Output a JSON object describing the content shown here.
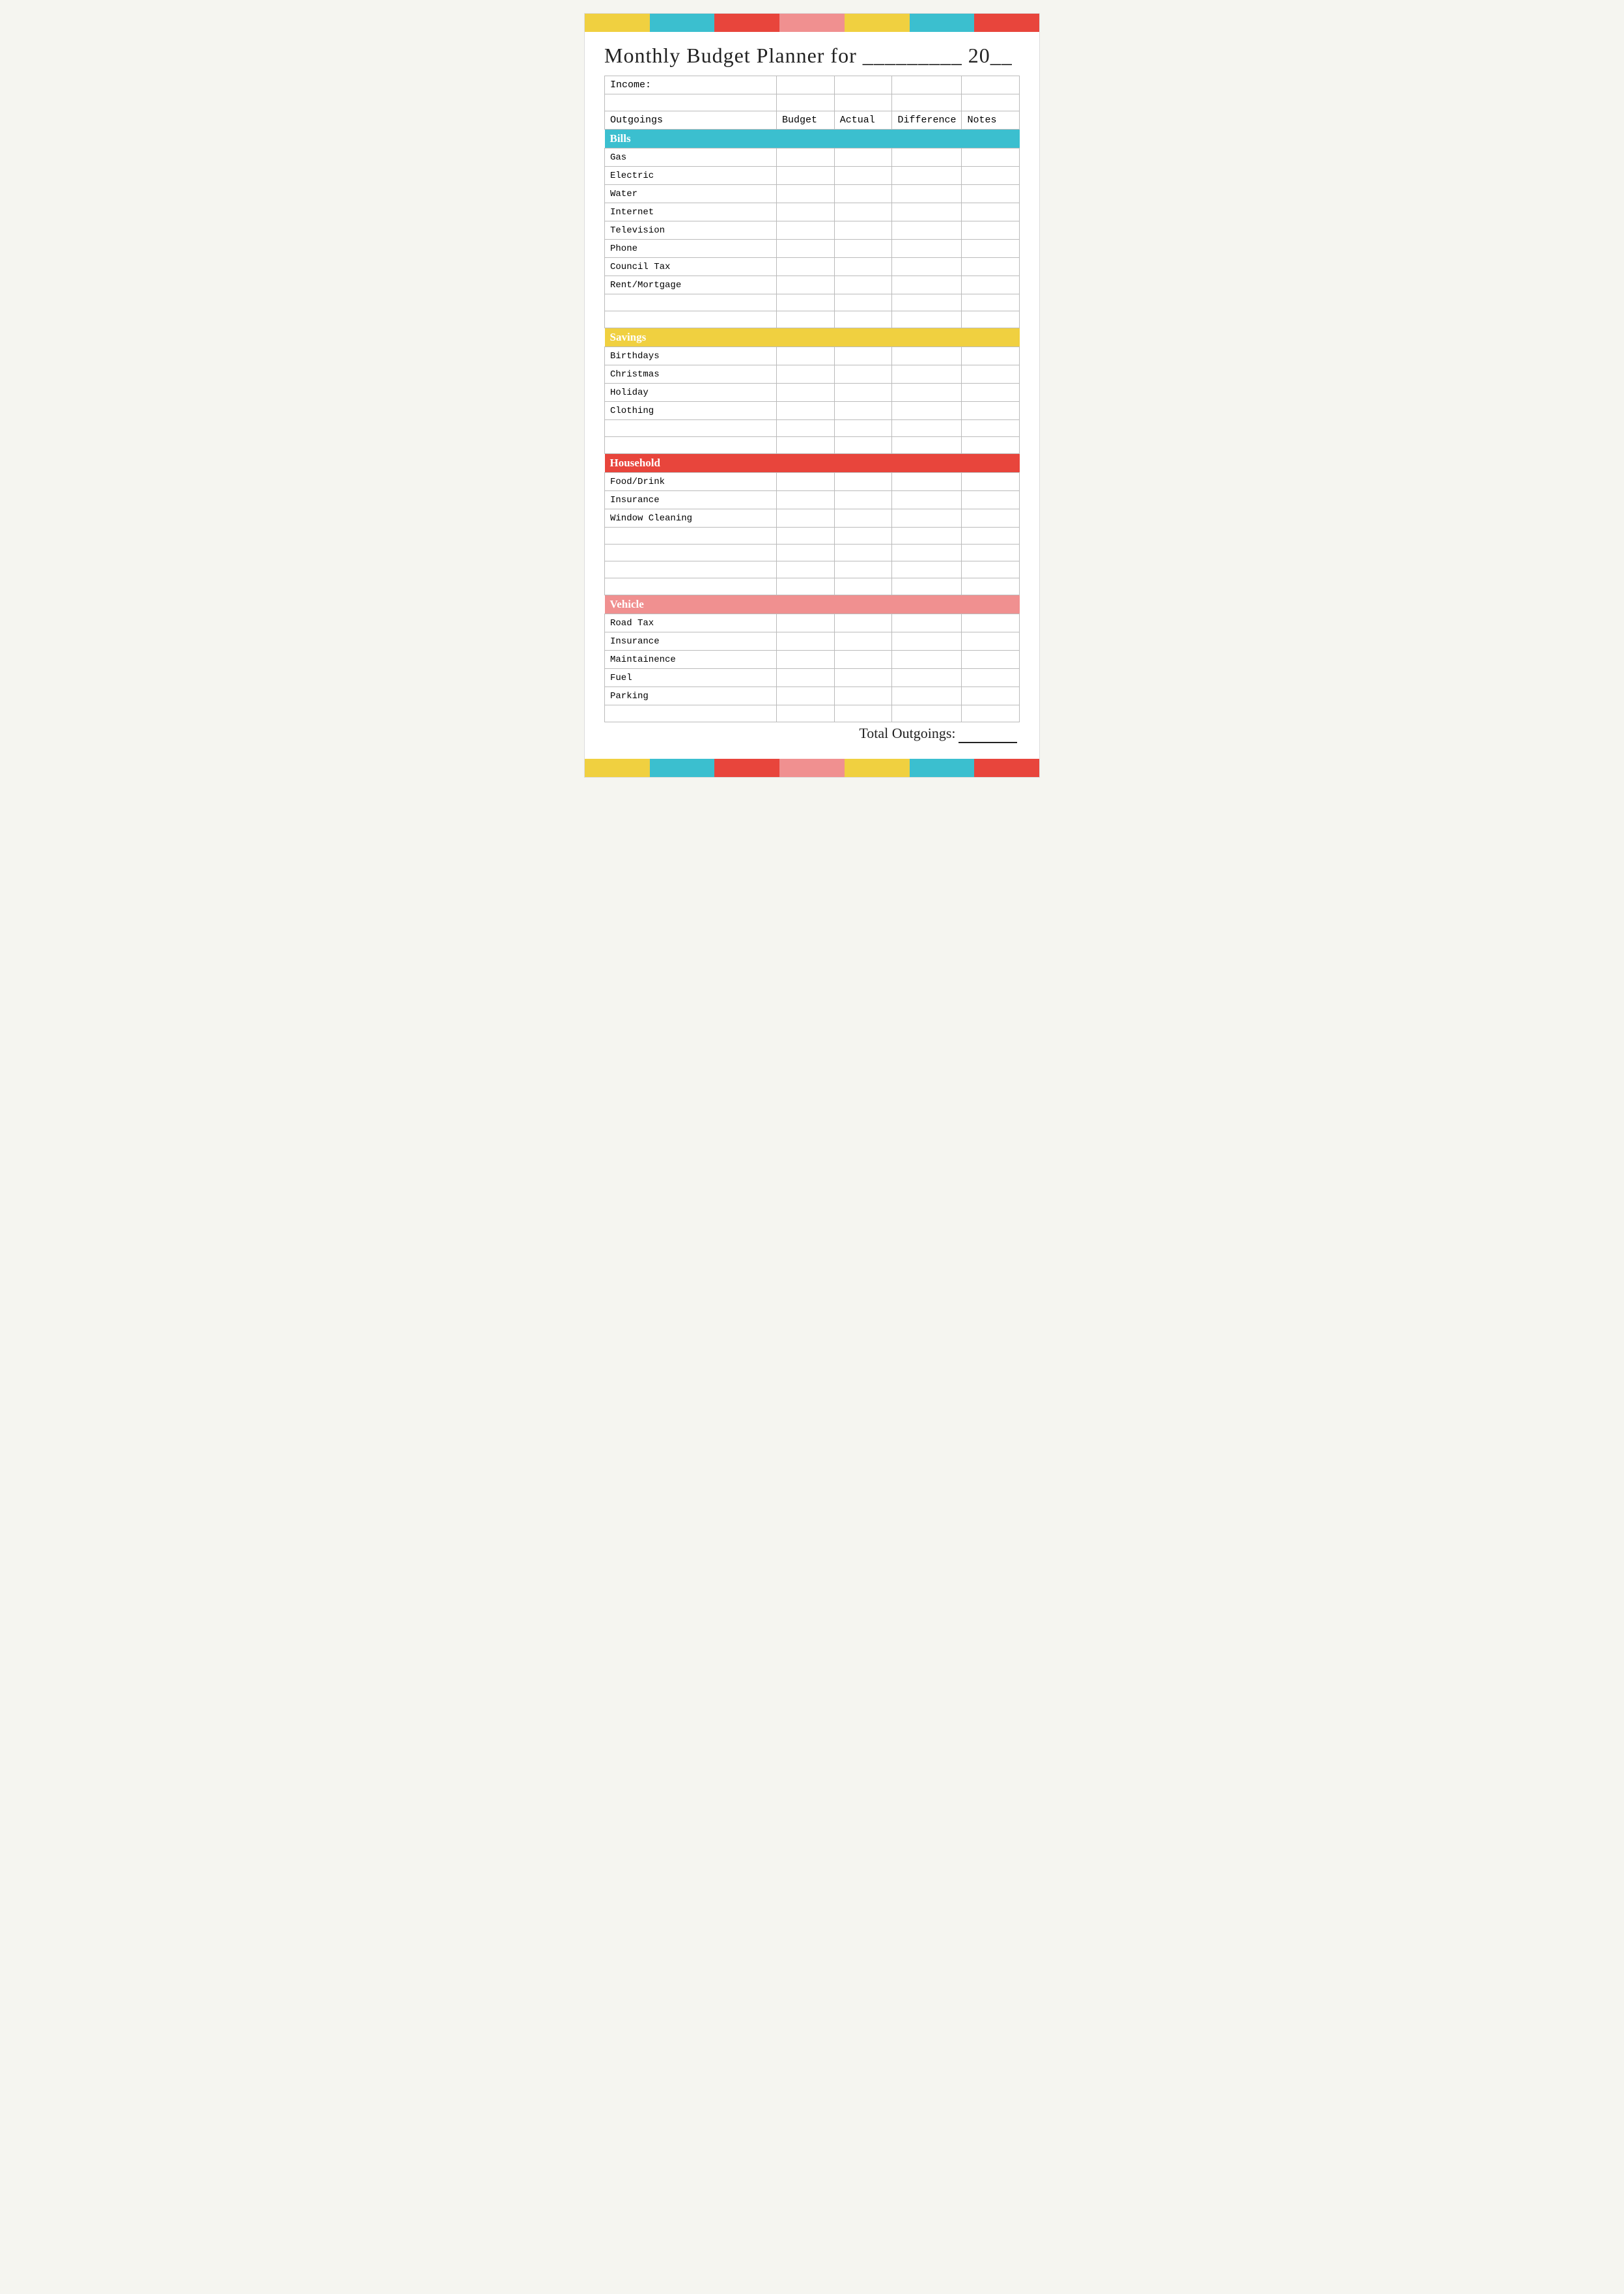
{
  "colorBar": {
    "segments": [
      "yellow",
      "teal",
      "red",
      "pink",
      "yellow2",
      "teal2",
      "red2"
    ]
  },
  "title": "Monthly Budget Planner for _________ 20__",
  "table": {
    "incomeLabel": "Income:",
    "columns": [
      "Outgoings",
      "Budget",
      "Actual",
      "Difference",
      "Notes"
    ],
    "sections": [
      {
        "id": "bills",
        "label": "Bills",
        "colorClass": "cat-bills",
        "rows": [
          "Gas",
          "Electric",
          "Water",
          "Internet",
          "Television",
          "Phone",
          "Council Tax",
          "Rent/Mortgage",
          "",
          ""
        ]
      },
      {
        "id": "savings",
        "label": "Savings",
        "colorClass": "cat-savings",
        "rows": [
          "Birthdays",
          "Christmas",
          "Holiday",
          "Clothing",
          "",
          ""
        ]
      },
      {
        "id": "household",
        "label": "Household",
        "colorClass": "cat-household",
        "rows": [
          "Food/Drink",
          "Insurance",
          "Window Cleaning",
          "",
          "",
          "",
          ""
        ]
      },
      {
        "id": "vehicle",
        "label": "Vehicle",
        "colorClass": "cat-vehicle",
        "rows": [
          "Road Tax",
          "Insurance",
          "Maintainence",
          "Fuel",
          "Parking",
          ""
        ]
      }
    ],
    "totalLabel": "Total Outgoings:______"
  }
}
